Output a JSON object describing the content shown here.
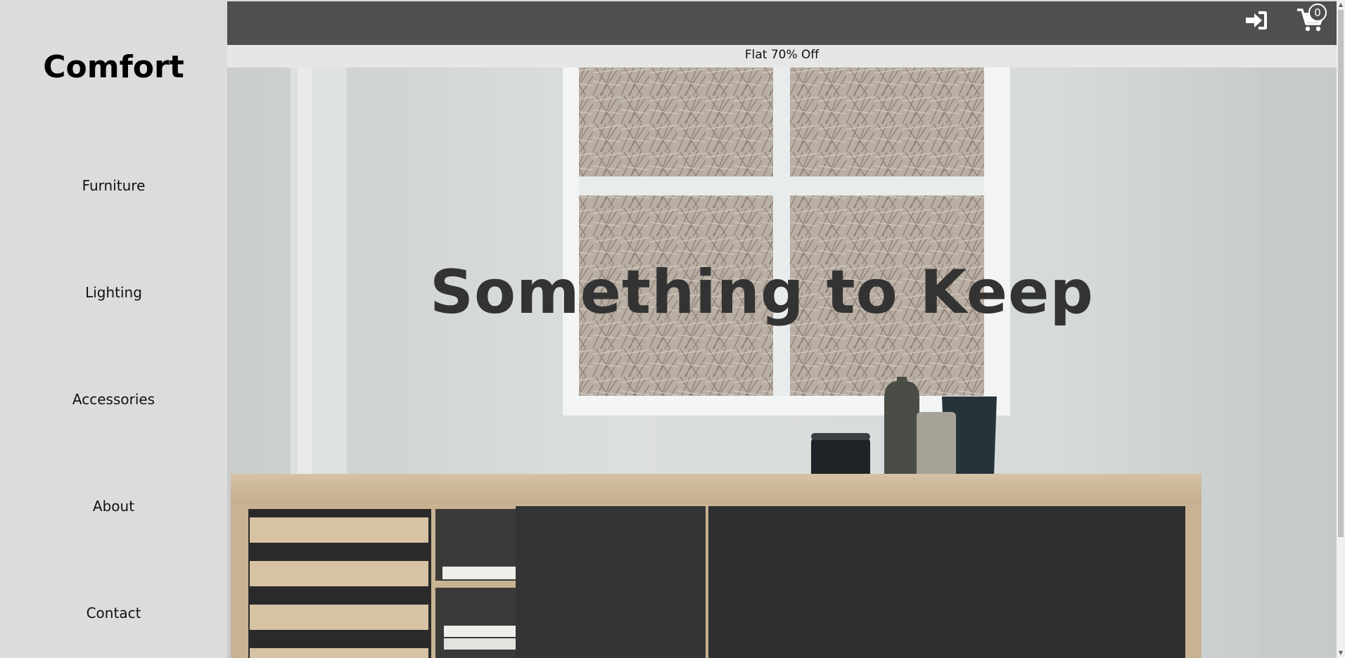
{
  "brand": {
    "name": "Comfort"
  },
  "sidebar": {
    "items": [
      {
        "label": "Furniture"
      },
      {
        "label": "Lighting"
      },
      {
        "label": "Accessories"
      },
      {
        "label": "About"
      },
      {
        "label": "Contact"
      }
    ]
  },
  "header": {
    "login_icon": "sign-in-icon",
    "cart_icon": "shopping-cart-icon",
    "cart_count": "0"
  },
  "promo": {
    "text": "Flat 70% Off"
  },
  "hero": {
    "title": "Something to Keep"
  },
  "colors": {
    "topbar": "#4f4f4f",
    "sidebar": "#dcdcdb",
    "promo": "#e6e6e5",
    "hero_title": "#333333"
  }
}
